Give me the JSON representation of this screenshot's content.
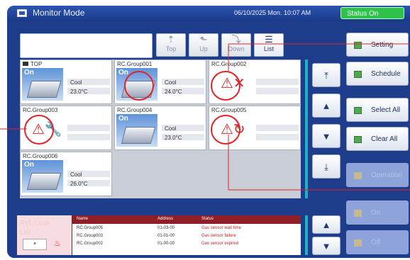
{
  "header": {
    "title": "Monitor Mode",
    "datetime": "06/10/2025 Mon. 10:07 AM",
    "status": "Status On"
  },
  "nav": [
    {
      "label": "Top",
      "icon": "arrow-up-icon"
    },
    {
      "label": "Up",
      "icon": "arrow-up-left-icon"
    },
    {
      "label": "Down",
      "icon": "arrow-down-right-icon"
    },
    {
      "label": "List",
      "icon": "list-icon"
    }
  ],
  "groups": [
    {
      "name": "TOP",
      "state": "On",
      "mode": "Cool",
      "temp": "23.0°C",
      "alert": false
    },
    {
      "name": "RC.Group001",
      "state": "On",
      "mode": "Cool",
      "temp": "24.0°C",
      "alert": false
    },
    {
      "name": "RC.Group002",
      "state": "",
      "mode": "",
      "temp": "",
      "alert": true
    },
    {
      "name": "RC.Group003",
      "state": "",
      "mode": "",
      "temp": "",
      "alert": true
    },
    {
      "name": "RC.Group004",
      "state": "On",
      "mode": "Cool",
      "temp": "23.0°C",
      "alert": false
    },
    {
      "name": "RC.Group005",
      "state": "",
      "mode": "",
      "temp": "",
      "alert": true
    },
    {
      "name": "RC.Group006",
      "state": "On",
      "mode": "Cool",
      "temp": "26.0°C",
      "alert": false
    }
  ],
  "sidebar": {
    "buttons": [
      {
        "label": "Setting",
        "enabled": true
      },
      {
        "label": "Schedule",
        "enabled": true
      },
      {
        "label": "Select All",
        "enabled": true
      },
      {
        "label": "Clear All",
        "enabled": true
      },
      {
        "label": "Operation",
        "enabled": false
      },
      {
        "label": "On",
        "enabled": false
      },
      {
        "label": "Off",
        "enabled": false
      }
    ]
  },
  "leak": {
    "title": "Ref. Leak List",
    "headers": [
      "Name",
      "Address",
      "Status"
    ],
    "rows": [
      {
        "name": "RC.Group005",
        "address": "01-03-00",
        "status": "Gas sensor wait time"
      },
      {
        "name": "RC.Group003",
        "address": "01-01-00",
        "status": "Gas sensor failure"
      },
      {
        "name": "RC.Group002",
        "address": "01-00-00",
        "status": "Gas sensor expired"
      }
    ]
  },
  "colors": {
    "background": "#1d3c8a",
    "status": "#2ec24a",
    "accent": "#1ab2c7",
    "alert": "#e3232a"
  }
}
